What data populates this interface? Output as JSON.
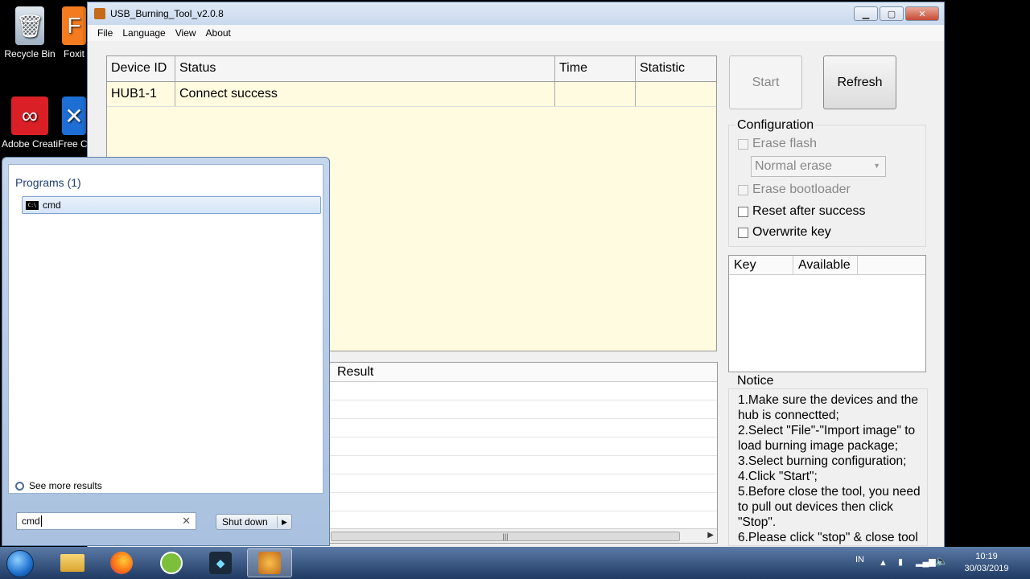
{
  "desktop": {
    "icons": [
      {
        "label": "Recycle Bin"
      },
      {
        "label": "Foxit"
      },
      {
        "label": "Adobe Creati..."
      },
      {
        "label": "Free C..."
      }
    ]
  },
  "app": {
    "title": "USB_Burning_Tool_v2.0.8",
    "menu": [
      "File",
      "Language",
      "View",
      "About"
    ],
    "device_table": {
      "headers": [
        "Device ID",
        "Status",
        "Time",
        "Statistic"
      ],
      "rows": [
        {
          "device_id": "HUB1-1",
          "status": "Connect success",
          "time": "",
          "statistic": ""
        }
      ]
    },
    "result_header": "Result",
    "buttons": {
      "start": "Start",
      "refresh": "Refresh"
    },
    "configuration": {
      "title": "Configuration",
      "erase_flash": "Erase flash",
      "erase_mode": "Normal erase",
      "erase_bootloader": "Erase bootloader",
      "reset_after_success": "Reset after success",
      "overwrite_key": "Overwrite key"
    },
    "key_table": {
      "headers": [
        "Key",
        "Available"
      ]
    },
    "notice": {
      "title": "Notice",
      "lines": [
        "1.Make sure the devices and the",
        "hub is connectted;",
        "2.Select \"File\"-\"Import image\" to",
        "load burning image package;",
        "3.Select burning configuration;",
        "4.Click \"Start\";",
        "5.Before close the tool, you need",
        "to pull out devices then click",
        "\"Stop\".",
        "6.Please click \"stop\" & close tool"
      ]
    }
  },
  "start_menu": {
    "programs_heading": "Programs (1)",
    "result": "cmd",
    "see_more": "See more results",
    "search_value": "cmd",
    "shutdown": "Shut down"
  },
  "taskbar": {
    "language": "IN",
    "time": "10:19",
    "date": "30/03/2019"
  }
}
